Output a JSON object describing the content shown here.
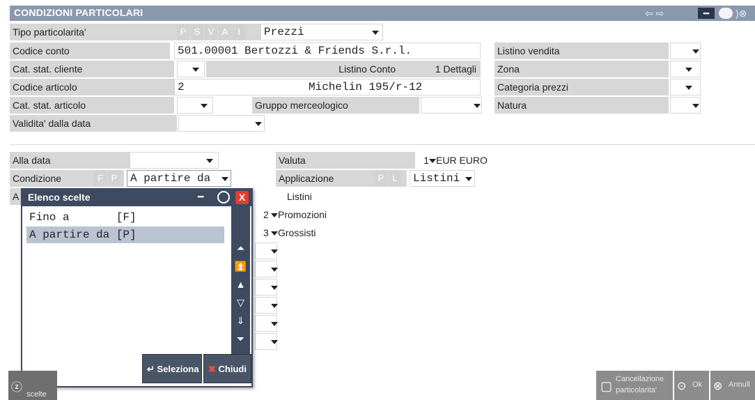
{
  "window": {
    "title": "CONDIZIONI PARTICOLARI",
    "nav_icons": [
      "<>",
      "pin",
      "close"
    ]
  },
  "form": {
    "tipo_label": "Tipo particolarita'",
    "tipo_flags": [
      "P",
      "S",
      "V",
      "A",
      "I"
    ],
    "tipo_value": "Prezzi",
    "codice_conto_label": "Codice conto",
    "codice_conto_value": "501.00001 Bertozzi & Friends S.r.l.",
    "listino_vendita_label": "Listino vendita",
    "cat_cliente_label": "Cat. stat. cliente",
    "listino_conto_label": "Listino Conto",
    "listino_conto_value": "1 Dettagli",
    "zona_label": "Zona",
    "codice_articolo_label": "Codice articolo",
    "codice_articolo_value": "2",
    "articolo_desc": "Michelin 195/r-12",
    "categoria_prezzi_label": "Categoria prezzi",
    "cat_articolo_label": "Cat. stat. articolo",
    "gruppo_label": "Gruppo merceologico",
    "natura_label": "Natura",
    "validita_label": "Validita' dalla data",
    "alla_data_label": "Alla data",
    "valuta_label": "Valuta",
    "valuta_num": "1",
    "valuta_value": "EUR EURO",
    "condizione_label": "Condizione",
    "condizione_flags": [
      "F",
      "P"
    ],
    "condizione_value": "A partire da",
    "applicazione_label": "Applicazione",
    "applicazione_flags": [
      "P",
      "L"
    ],
    "applicazione_value": "Listini",
    "hidden_label_initial": "A",
    "listini_heading": "Listini",
    "listini": [
      {
        "num": "2",
        "name": "Promozioni"
      },
      {
        "num": "3",
        "name": "Grossisti"
      }
    ]
  },
  "popup": {
    "title": "Elenco scelte",
    "items": [
      {
        "label": "Fino a       [F]",
        "selected": false
      },
      {
        "label": "A partire da [P]",
        "selected": true
      }
    ],
    "select_button": "Seleziona",
    "close_button": "Chiudi"
  },
  "bottom": {
    "scelte_label": "scelte",
    "cancel_label_1": "Cancellazione",
    "cancel_label_2": "particolarita'",
    "ok_label": "Ok",
    "annulla_label": "Annull"
  }
}
